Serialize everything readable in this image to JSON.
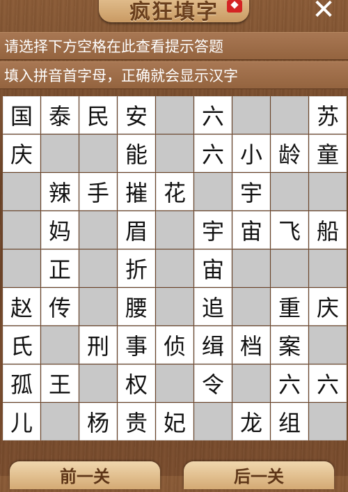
{
  "header": {
    "title": "疯狂填字",
    "badge_icon": "red-ribbon-icon",
    "close_glyph": "✕"
  },
  "hints": [
    "请选择下方空格在此查看提示答题",
    "填入拼音首字母，正确就会显示汉字"
  ],
  "grid": [
    [
      "国",
      "泰",
      "民",
      "安",
      "",
      "六",
      "",
      "",
      "苏"
    ],
    [
      "庆",
      "",
      "",
      "能",
      "",
      "六",
      "小",
      "龄",
      "童"
    ],
    [
      "",
      "辣",
      "手",
      "摧",
      "花",
      "",
      "宇",
      "",
      ""
    ],
    [
      "",
      "妈",
      "",
      "眉",
      "",
      "宇",
      "宙",
      "飞",
      "船"
    ],
    [
      "",
      "正",
      "",
      "折",
      "",
      "宙",
      "",
      "",
      ""
    ],
    [
      "赵",
      "传",
      "",
      "腰",
      "",
      "追",
      "",
      "重",
      "庆"
    ],
    [
      "氏",
      "",
      "刑",
      "事",
      "侦",
      "缉",
      "档",
      "案",
      ""
    ],
    [
      "孤",
      "王",
      "",
      "权",
      "",
      "令",
      "",
      "六",
      "六"
    ],
    [
      "儿",
      "",
      "杨",
      "贵",
      "妃",
      "",
      "龙",
      "组",
      ""
    ]
  ],
  "footer": {
    "prev_label": "前一关",
    "next_label": "后一关"
  },
  "colors": {
    "background": "#6b4226",
    "empty_cell": "#c8c8c8",
    "filled_cell": "#ffffff"
  }
}
